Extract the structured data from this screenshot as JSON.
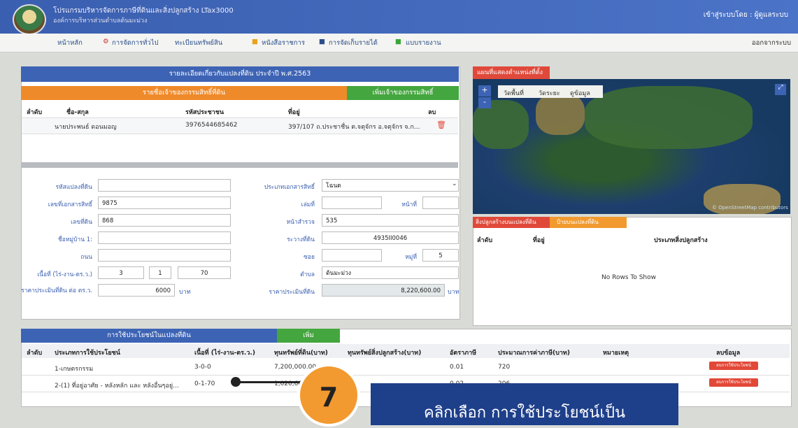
{
  "header": {
    "title_line1": "โปรแกรมบริหารจัดการภาษีที่ดินและสิ่งปลูกสร้าง LTax3000",
    "title_line2": "องค์การบริหารส่วนตำบลต้นมะม่วง",
    "login_text": "เข้าสู่ระบบโดย : ผู้ดูแลระบบ"
  },
  "nav": {
    "home": "หน้าหลัก",
    "general": "การจัดการทั่วไป",
    "registry": "ทะเบียนทรัพย์สิน",
    "docs": "หนังสือราชการ",
    "tax": "การจัดเก็บรายได้",
    "reports": "แบบรายงาน",
    "logout": "ออกจากระบบ"
  },
  "parcel": {
    "header": "รายละเอียดเกี่ยวกับแปลงที่ดิน ประจำปี พ.ศ.2563",
    "owners_header": "รายชื่อเจ้าของกรรมสิทธิ์ที่ดิน",
    "add_owner": "เพิ่มเจ้าของกรรมสิทธิ์",
    "cols": {
      "seq": "ลำดับ",
      "name": "ชื่อ-สกุล",
      "id": "รหัสประชาชน",
      "addr": "ที่อยู่",
      "del": "ลบ"
    },
    "owner_row": {
      "name": "นายประพนธ์ ดอนมอญ",
      "id": "3976544685462",
      "addr": "397/107 ถ.ประชาชื่น ต.จตุจักร อ.จตุจักร จ.ก..."
    }
  },
  "form": {
    "parcel_code_label": "รหัสแปลงที่ดิน",
    "doc_no_label": "เลขที่เอกสารสิทธิ์",
    "doc_no": "9875",
    "land_no_label": "เลขที่ดิน",
    "land_no": "868",
    "village_label": "ชื่อหมู่บ้าน 1:",
    "road_label": "ถนน",
    "area_label": "เนื้อที่ (ไร่-งาน-ตร.ว.)",
    "rai": "3",
    "ngan": "1",
    "wa": "70",
    "price_label": "ราคาประเมินที่ดิน ต่อ ตร.ว.",
    "price": "6000",
    "baht": "บาท",
    "doc_type_label": "ประเภทเอกสารสิทธิ์",
    "doc_type": "โฉนด",
    "book_label": "เล่มที่",
    "page_label": "หน้าที่",
    "survey_label": "หน้าสำรวจ",
    "survey": "535",
    "coord_label": "ระวางที่ดิน",
    "coord": "4935II0046",
    "soi_label": "ซอย",
    "moo_label": "หมู่ที่",
    "moo": "5",
    "tambon_label": "ตำบล",
    "tambon": "ต้นมะม่วง",
    "appraisal_label": "ราคาประเมินที่ดิน",
    "appraisal": "8,220,600.00",
    "appraisal_unit": "บาท"
  },
  "map": {
    "header": "แผนที่แสดงตำแหน่งที่ตั้ง",
    "plus": "+",
    "minus": "-",
    "tab1": "วัดพื้นที่",
    "tab2": "วัดระยะ",
    "tab3": "ดูข้อมูล",
    "credit": "© OpenStreetMap contributors"
  },
  "buildings": {
    "tab1": "สิ่งปลูกสร้างบนแปลงที่ดิน",
    "tab2": "ป้ายบนแปลงที่ดิน",
    "col_seq": "ลำดับ",
    "col_addr": "ที่อยู่",
    "col_type": "ประเภทสิ่งปลูกสร้าง",
    "empty": "No Rows To Show"
  },
  "usage": {
    "header": "การใช้ประโยชน์ในแปลงที่ดิน",
    "add": "เพิ่ม",
    "cols": {
      "seq": "ลำดับ",
      "type": "ประเภทการใช้ประโยชน์",
      "area": "เนื้อที่ (ไร่-งาน-ตร.ว.)",
      "land_cap": "ทุนทรัพย์ที่ดิน(บาท)",
      "bld_cap": "ทุนทรัพย์สิ่งปลูกสร้าง(บาท)",
      "rate": "อัตราภาษี",
      "tax": "ประมาณการค่าภาษี(บาท)",
      "note": "หมายเหตุ",
      "del": "ลบข้อมูล"
    },
    "rows": [
      {
        "type": "1-เกษตรกรรม",
        "area": "3-0-0",
        "land_cap": "7,200,000.00",
        "rate": "0.01",
        "tax": "720",
        "btn": "ลบการใช้ประโยชน์"
      },
      {
        "type": "2-(1) ที่อยู่อาศัย - หลังหลัก และ หลังอื่นๆอยู่...",
        "area": "0-1-70",
        "land_cap": "1,020,600.00",
        "rate": "0.02",
        "tax": "206",
        "btn": "ลบการใช้ประโยชน์"
      }
    ]
  },
  "callout": {
    "number": "7",
    "text": "คลิกเลือก การใช้ประโยชน์เป็น"
  }
}
